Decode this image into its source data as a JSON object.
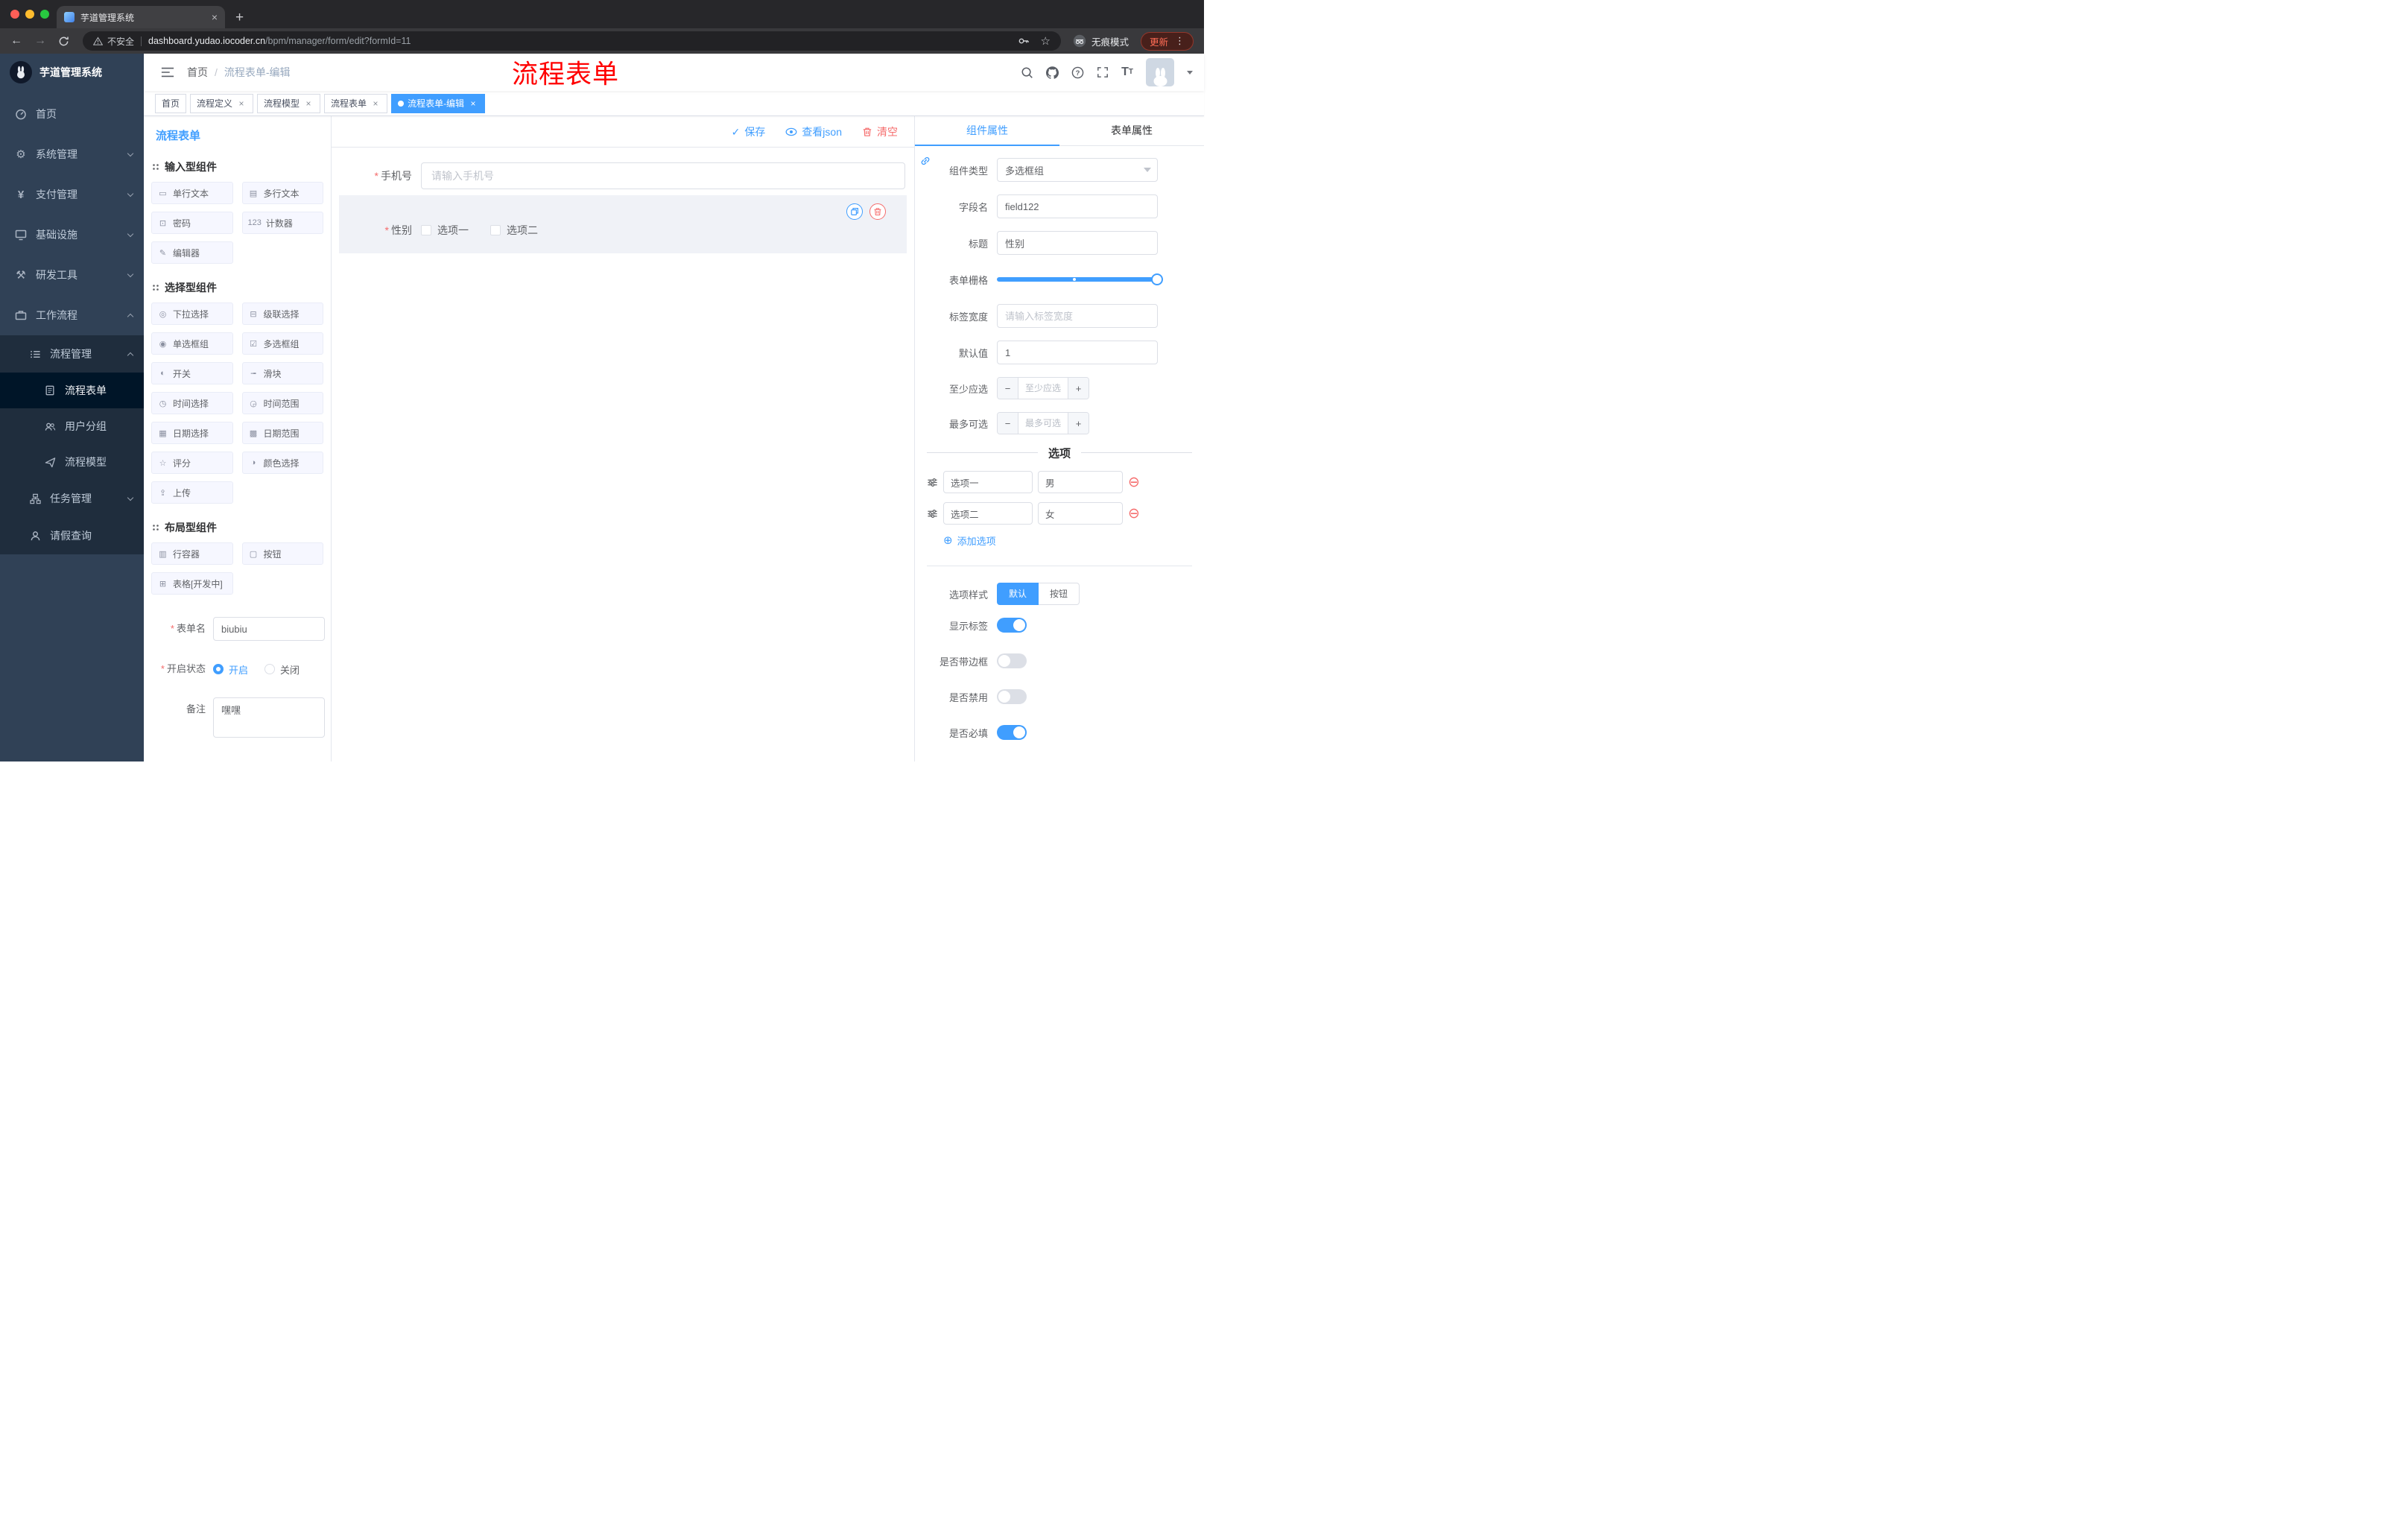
{
  "colors": {
    "accent": "#409EFF",
    "danger": "#F56C6C",
    "annotation": "#FF0000",
    "sidebar_bg": "#304156",
    "submenu_bg": "#1F2D3D",
    "active_item_bg": "#001528"
  },
  "chrome": {
    "tab_title": "芋道管理系统",
    "security": "不安全",
    "url_host": "dashboard.yudao.iocoder.cn",
    "url_path": "/bpm/manager/form/edit?formId=11",
    "incognito": "无痕模式",
    "update": "更新"
  },
  "annotation": "流程表单",
  "navbar": {
    "breadcrumb_home": "首页",
    "breadcrumb_current": "流程表单-编辑"
  },
  "sidebar": {
    "logo_title": "芋道管理系统",
    "home": "首页",
    "system": "系统管理",
    "pay": "支付管理",
    "infra": "基础设施",
    "devtools": "研发工具",
    "workflow": "工作流程",
    "process_mgmt": "流程管理",
    "process_form": "流程表单",
    "user_group": "用户分组",
    "process_model": "流程模型",
    "task_mgmt": "任务管理",
    "leave_query": "请假查询"
  },
  "tags": {
    "items": [
      "首页",
      "流程定义",
      "流程模型",
      "流程表单",
      "流程表单-编辑"
    ]
  },
  "page": {
    "title": "流程表单",
    "save": "保存",
    "view_json": "查看json",
    "clear": "清空"
  },
  "palette": {
    "group_input": "输入型组件",
    "group_select": "选择型组件",
    "group_layout": "布局型组件",
    "items_input": [
      {
        "icon": "▭",
        "label": "单行文本"
      },
      {
        "icon": "▤",
        "label": "多行文本"
      },
      {
        "icon": "⊡",
        "label": "密码"
      },
      {
        "icon": "123",
        "label": "计数器"
      },
      {
        "icon": "✎",
        "label": "编辑器"
      }
    ],
    "items_select": [
      {
        "icon": "◎",
        "label": "下拉选择"
      },
      {
        "icon": "⊟",
        "label": "级联选择"
      },
      {
        "icon": "◉",
        "label": "单选框组"
      },
      {
        "icon": "☑",
        "label": "多选框组"
      },
      {
        "icon": "◐",
        "label": "开关"
      },
      {
        "icon": "╼",
        "label": "滑块"
      },
      {
        "icon": "◷",
        "label": "时间选择"
      },
      {
        "icon": "◶",
        "label": "时间范围"
      },
      {
        "icon": "▦",
        "label": "日期选择"
      },
      {
        "icon": "▩",
        "label": "日期范围"
      },
      {
        "icon": "☆",
        "label": "评分"
      },
      {
        "icon": "◑",
        "label": "颜色选择"
      },
      {
        "icon": "⇪",
        "label": "上传"
      }
    ],
    "items_layout": [
      {
        "icon": "▥",
        "label": "行容器"
      },
      {
        "icon": "▢",
        "label": "按钮"
      },
      {
        "icon": "⊞",
        "label": "表格[开发中]"
      }
    ]
  },
  "form_meta": {
    "name_label": "表单名",
    "name_value": "biubiu",
    "status_label": "开启状态",
    "status_on": "开启",
    "status_off": "关闭",
    "remark_label": "备注",
    "remark_value": "嘿嘿"
  },
  "canvas": {
    "phone_label": "手机号",
    "phone_placeholder": "请输入手机号",
    "gender_label": "性别",
    "gender_options": [
      "选项一",
      "选项二"
    ]
  },
  "props": {
    "tab_component": "组件属性",
    "tab_form": "表单属性",
    "rows": {
      "type_label": "组件类型",
      "type_value": "多选框组",
      "field_label": "字段名",
      "field_value": "field122",
      "title_label": "标题",
      "title_value": "性别",
      "grid_label": "表单栅格",
      "label_width_label": "标签宽度",
      "label_width_placeholder": "请输入标签宽度",
      "default_label": "默认值",
      "default_value": "1",
      "min_label": "至少应选",
      "min_placeholder": "至少应选",
      "max_label": "最多可选",
      "max_placeholder": "最多可选"
    },
    "options_title": "选项",
    "options": [
      {
        "label": "选项一",
        "value": "男"
      },
      {
        "label": "选项二",
        "value": "女"
      }
    ],
    "add_option": "添加选项",
    "style_label": "选项样式",
    "style_default": "默认",
    "style_button": "按钮",
    "toggles": {
      "show_label": "显示标签",
      "border": "是否带边框",
      "disabled": "是否禁用",
      "required": "是否必填"
    }
  }
}
